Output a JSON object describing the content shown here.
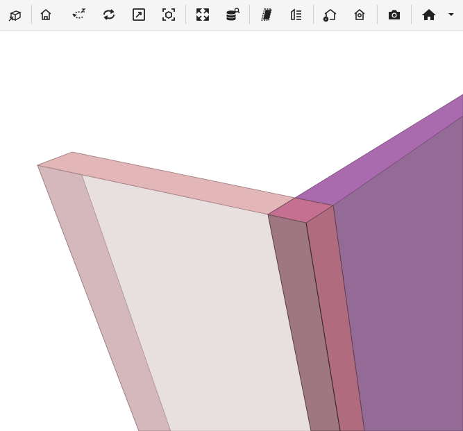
{
  "toolbar": {
    "buttons": [
      {
        "id": "view-cube",
        "icon": "view-cube-icon"
      },
      {
        "id": "home",
        "icon": "home-icon"
      },
      {
        "id": "orbit-z",
        "icon": "orbit-z-icon"
      },
      {
        "id": "rotate",
        "icon": "rotate-icon"
      },
      {
        "id": "zoom-window",
        "icon": "zoom-window-icon"
      },
      {
        "id": "zoom-selection",
        "icon": "zoom-selection-icon"
      },
      {
        "id": "fit-all",
        "icon": "fit-all-icon"
      },
      {
        "id": "search-database",
        "icon": "database-search-icon"
      },
      {
        "id": "section-plane",
        "icon": "section-plane-icon"
      },
      {
        "id": "layer-list",
        "icon": "layer-list-icon"
      },
      {
        "id": "house-settings",
        "icon": "house-settings-icon"
      },
      {
        "id": "house-location",
        "icon": "house-location-icon"
      },
      {
        "id": "screenshot",
        "icon": "camera-icon"
      },
      {
        "id": "navigation-home",
        "icon": "home-navigation-icon"
      }
    ],
    "dropdown_icon": "chevron-down-icon"
  },
  "scene": {
    "objects": [
      {
        "name": "pink-wall-panel",
        "face_color": "#e8dfe0",
        "side_color": "#d4b8bb",
        "top_color": "#e3b6b8"
      },
      {
        "name": "purple-wall-panel",
        "face_color": "#946a96",
        "side_color": "#b06c7e",
        "top_color": "#a96aae"
      },
      {
        "name": "junction-block",
        "color": "#c57090"
      }
    ]
  }
}
